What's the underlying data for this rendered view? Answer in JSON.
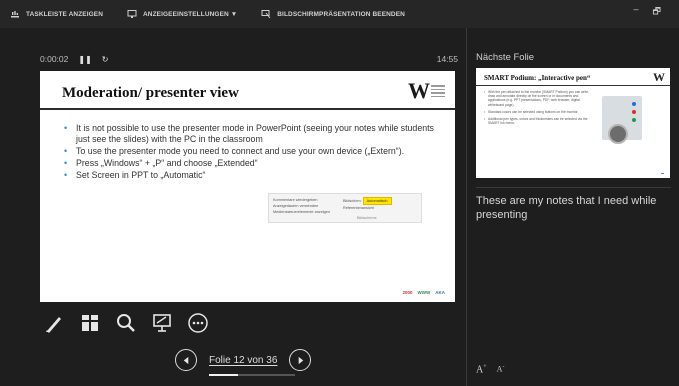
{
  "toolbar": {
    "taskbar_label": "TASKLEISTE ANZEIGEN",
    "display_settings_label": "ANZEIGEEINSTELLUNGEN ▼",
    "end_show_label": "BILDSCHIRMPRÄSENTATION BEENDEN"
  },
  "window_controls": {
    "minimize": "–",
    "restore": "🗗"
  },
  "timer": {
    "elapsed": "0:00:02",
    "pause_icon": "❚❚",
    "reset_icon": "↻",
    "clock": "14:55"
  },
  "current_slide": {
    "title": "Moderation/ presenter view",
    "logo_text": "W",
    "bullets": [
      "It is not possible to use the presenter mode in PowerPoint (seeing your notes while students just see the slides) with the PC in the classroom",
      "To use the presenter mode you need to connect and use your own device („Extern“).",
      "Press „Windows“ + „P“ and choose „Extended“",
      "Set Screen in PPT to „Automatic“"
    ],
    "inset": {
      "items_left": [
        "Kommentare wiedergeben",
        "Anzeigedauern verwenden",
        "Medienssteuerelemente anzeigen"
      ],
      "monitor_label": "Bildschirm:",
      "monitor_value": "Automatisch",
      "presenter_view": "Referentenansicht",
      "caption": "Bildschirme"
    },
    "footer_logos": [
      "2000",
      "WWW",
      "AKA"
    ]
  },
  "tools": {
    "pen": "pen-tool-icon",
    "all_slides": "see-all-slides-icon",
    "zoom": "zoom-icon",
    "screen": "screen-settings-icon",
    "more": "more-options-icon"
  },
  "navigation": {
    "counter": "Folie 12 von 36",
    "current": 12,
    "total": 36
  },
  "next_slide": {
    "label": "Nächste Folie",
    "title": "SMART Podium: „Interactive pen“",
    "logo_text": "W",
    "bullets": [
      "With the pen attached to the monitor (SMART Podium) you can write, draw and annotate directly on the screen or in documents and applications (e.g. PPT presentations, PDF, web browser, digital whiteboard page).",
      "Standard colors can be selected using buttons on the monitor.",
      "Additional pen types, colors and thicknesses can be selected via the SMART Ink menu."
    ]
  },
  "notes": {
    "text": "These are my notes that I need while presenting"
  },
  "font_controls": {
    "increase": "A",
    "decrease": "A"
  },
  "colors": {
    "background": "#1e1e1e",
    "bullet_accent": "#2a8bbf",
    "highlight": "#ffe600"
  }
}
